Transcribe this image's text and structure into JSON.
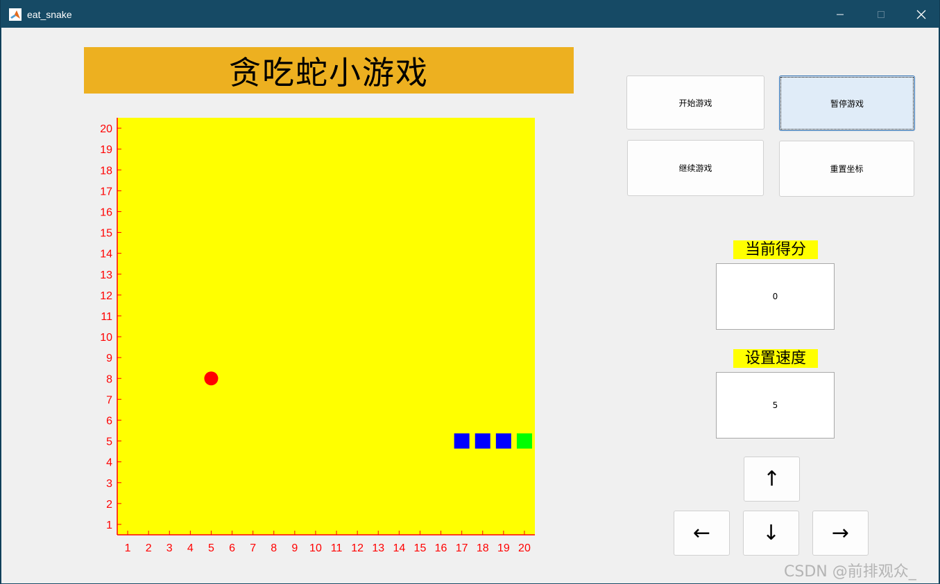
{
  "window": {
    "title": "eat_snake",
    "controls": {
      "minimize": "—",
      "maximize": "☐",
      "close": "✕"
    }
  },
  "banner": {
    "title": "贪吃蛇小游戏"
  },
  "buttons": {
    "start": "开始游戏",
    "pause": "暂停游戏",
    "resume": "继续游戏",
    "reset": "重置坐标"
  },
  "score": {
    "label": "当前得分",
    "value": "0"
  },
  "speed": {
    "label": "设置速度",
    "value": "5"
  },
  "direction": {
    "up": "↑",
    "down": "↓",
    "left": "←",
    "right": "→"
  },
  "watermark": "CSDN @前排观众_",
  "colors": {
    "banner": "#edb020",
    "board": "#ffff00",
    "axis": "#ff0000",
    "food": "#ff0000",
    "snake_body": "#0000ff",
    "snake_head": "#00ff00"
  },
  "game": {
    "xticks": [
      1,
      2,
      3,
      4,
      5,
      6,
      7,
      8,
      9,
      10,
      11,
      12,
      13,
      14,
      15,
      16,
      17,
      18,
      19,
      20
    ],
    "yticks": [
      1,
      2,
      3,
      4,
      5,
      6,
      7,
      8,
      9,
      10,
      11,
      12,
      13,
      14,
      15,
      16,
      17,
      18,
      19,
      20
    ],
    "xlim": [
      0.5,
      20.5
    ],
    "ylim": [
      0.5,
      20.5
    ],
    "food": {
      "x": 5,
      "y": 8
    },
    "snake_body": [
      {
        "x": 17,
        "y": 5
      },
      {
        "x": 18,
        "y": 5
      },
      {
        "x": 19,
        "y": 5
      }
    ],
    "snake_head": {
      "x": 20,
      "y": 5
    }
  }
}
